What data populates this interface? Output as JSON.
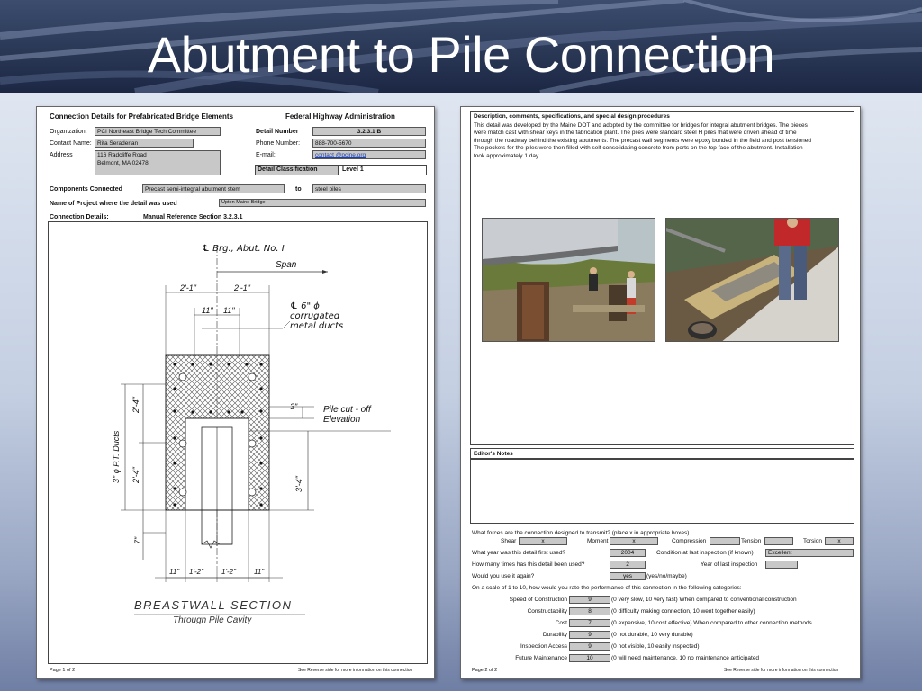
{
  "slide": {
    "title": "Abutment to Pile Connection"
  },
  "page1": {
    "heading": "Connection Details for Prefabricated Bridge Elements",
    "agency": "Federal Highway Administration",
    "org_label": "Organization:",
    "org_value": "PCI Northeast Bridge Tech Committee",
    "contact_label": "Contact Name:",
    "contact_value": "Rita Seraderian",
    "address_label": "Address",
    "address_line1": "116 Radcliffe Road",
    "address_line2": "Belmont, MA  02478",
    "detail_number_label": "Detail Number",
    "detail_number_value": "3.2.3.1 B",
    "phone_label": "Phone Number:",
    "phone_value": "888-700-5670",
    "email_label": "E-mail:",
    "email_value": "contact @pcine.org",
    "classification_label": "Detail Classification",
    "classification_value": "Level 1",
    "components_label": "Components Connected",
    "component_a": "Precast semi-integral abutment stem",
    "to_label": "to",
    "component_b": "steel piles",
    "project_label": "Name of Project where the detail was used",
    "project_value": "Upton Maine Bridge",
    "details_label": "Connection Details:",
    "manual_ref": "Manual Reference Section 3.2.3.1",
    "footer_left": "Page 1 of 2",
    "footer_right": "See Reverse side for more information on this connection"
  },
  "drawing": {
    "centerline": "℄ Brg., Abut. No. I",
    "span": "Span",
    "dim_21a": "2'-1\"",
    "dim_21b": "2'-1\"",
    "dim_11a": "11\"",
    "dim_11b": "11\"",
    "duct_line1": "℄ 6\" ϕ",
    "duct_line2": "corrugated",
    "duct_line3": "metal ducts",
    "pile_cutoff1": "Pile cut - off",
    "pile_cutoff2": "Elevation",
    "dim_3in": "3\"",
    "dim_24a": "2'-4\"",
    "dim_24b": "2'-4\"",
    "dim_34": "3'-4\"",
    "dim_7": "7\"",
    "pt_ducts": "3\" ϕ P.T. Ducts",
    "bottom_11a": "11\"",
    "bottom_12a": "1'-2\"",
    "bottom_12b": "1'-2\"",
    "bottom_11b": "11\"",
    "section_title": "BREASTWALL SECTION",
    "section_sub": "Through Pile Cavity"
  },
  "page2": {
    "desc_heading": "Description, comments, specifications, and special design procedures",
    "desc_lines": [
      "This detail was developed by the Maine DOT and adopted by the committee for bridges for integral abutment bridges.  The pieces",
      "were match cast with shear keys in the fabrication plant.  The piles were standard steel H piles that were driven ahead of time",
      "through the roadway behind the existing abutments.  The precast wall segments were epoxy bonded in the field and post tensioned",
      "The pockets for the piles were then filled with self consolidating concrete from ports on the top face of the abutment.  Installation",
      "took approximately 1 day."
    ],
    "editor_heading": "Editor's Notes",
    "forces_question": "What forces are the connection designed to transmit?  (place x in appropriate boxes)",
    "shear_label": "Shear",
    "shear_value": "x",
    "moment_label": "Moment",
    "moment_value": "x",
    "compression_label": "Compression",
    "compression_value": "",
    "tension_label": "Tension",
    "tension_value": "",
    "torsion_label": "Torsion",
    "torsion_value": "x",
    "year_question": "What year was this detail first used?",
    "year_value": "2004",
    "condition_label": "Condition at last inspection (if known)",
    "condition_value": "Excellent",
    "times_question": "How many times has this detail been used?",
    "times_value": "2",
    "last_inspection_label": "Year of last inspection",
    "last_inspection_value": "",
    "reuse_question": "Would you use it again?",
    "reuse_value": "yes",
    "reuse_hint": "(yes/no/maybe)",
    "scale_question": "On a scale of 1 to 10, how would you rate the performance of this connection in the following categories:",
    "ratings": [
      {
        "label": "Speed of Construction",
        "value": "9",
        "hint": "(0 very slow, 10 very fast)  When compared to conventional construction"
      },
      {
        "label": "Constructability",
        "value": "8",
        "hint": "(0 difficulty making connection, 10 went together easily)"
      },
      {
        "label": "Cost",
        "value": "7",
        "hint": "(0 expensive, 10 cost effective)  When compared to other connection methods"
      },
      {
        "label": "Durability",
        "value": "9",
        "hint": "(0 not durable, 10 very durable)"
      },
      {
        "label": "Inspection Access",
        "value": "9",
        "hint": "(0 not visible,  10 easily inspected)"
      },
      {
        "label": "Future Maintenance",
        "value": "10",
        "hint": "(0 will need maintenance, 10 no maintenance anticipated"
      }
    ],
    "footer_left": "Page 2 of 2",
    "footer_right": "See Reverse side for more information on this connection"
  }
}
